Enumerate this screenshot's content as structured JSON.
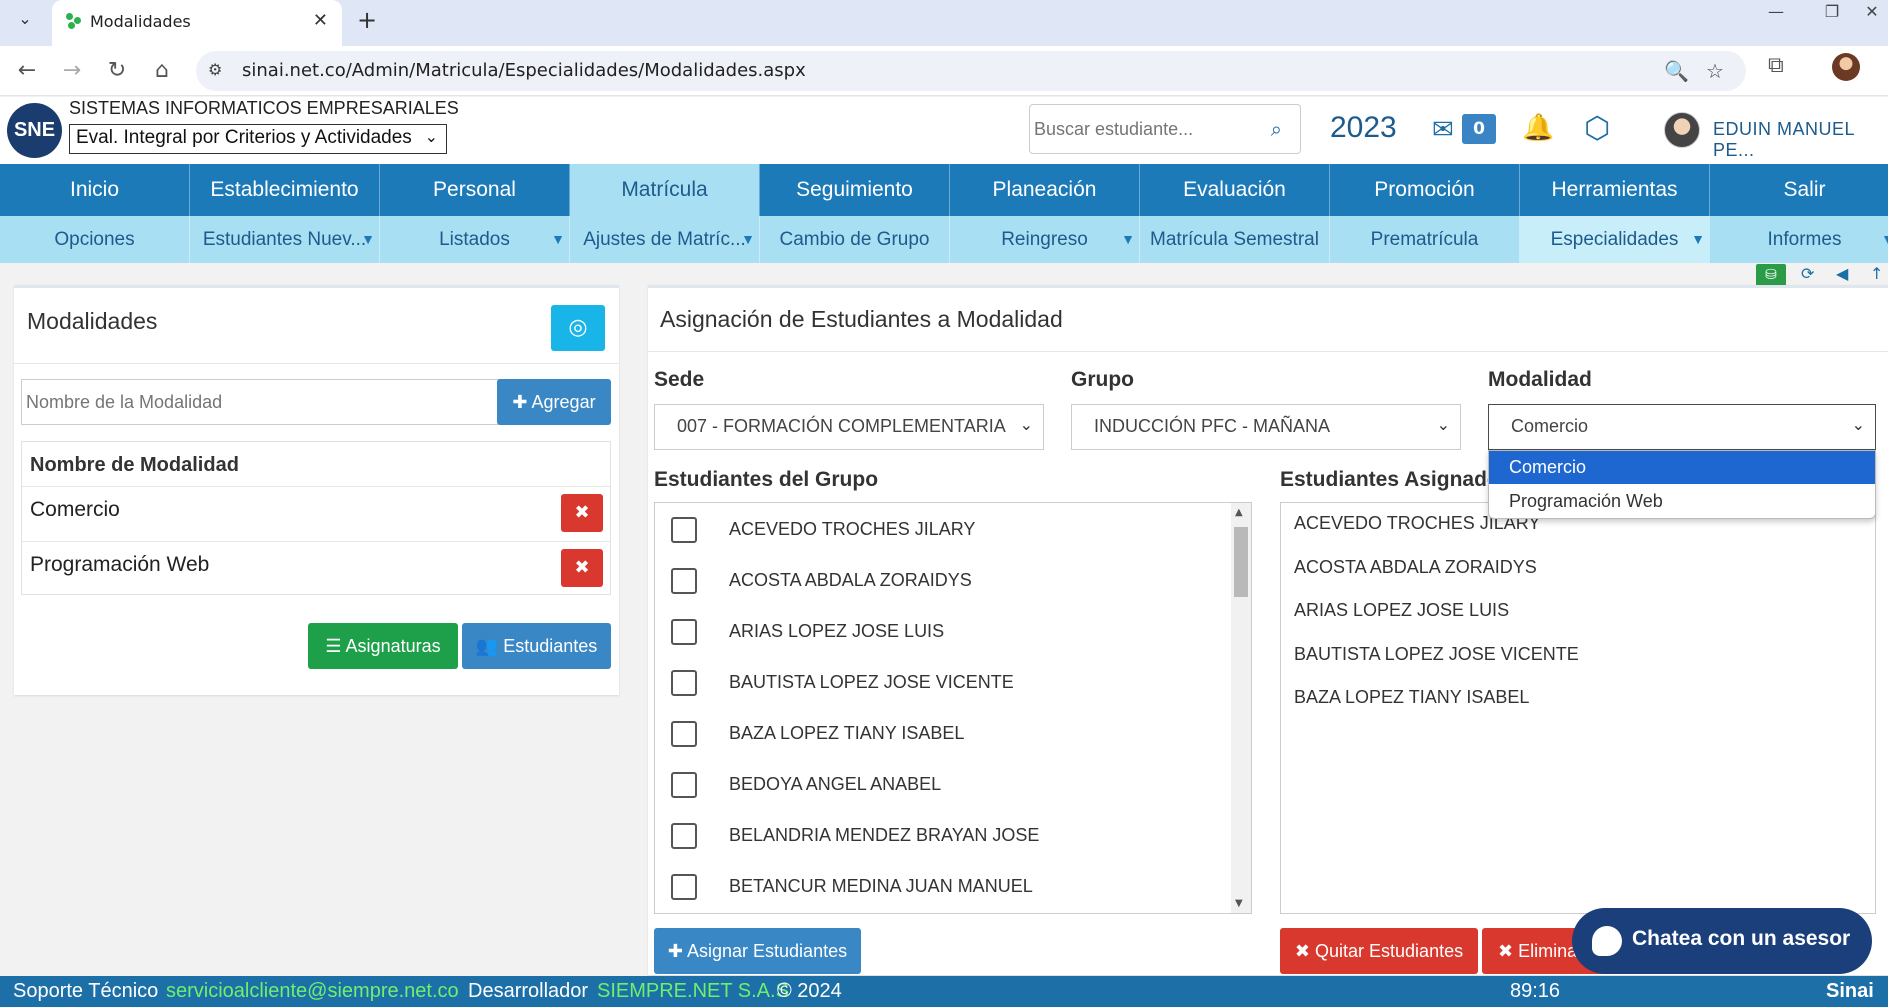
{
  "browser": {
    "tab_title": "Modalidades",
    "url": "sinai.net.co/Admin/Matricula/Especialidades/Modalidades.aspx"
  },
  "header": {
    "company": "SISTEMAS INFORMATICOS EMPRESARIALES",
    "logo_text": "SNE",
    "eval_select": "Eval. Integral por Criterios y Actividades",
    "search_placeholder": "Buscar estudiante...",
    "year": "2023",
    "mail_count": "0",
    "username": "EDUIN MANUEL PE..."
  },
  "main_menu": [
    "Inicio",
    "Establecimiento",
    "Personal",
    "Matrícula",
    "Seguimiento",
    "Planeación",
    "Evaluación",
    "Promoción",
    "Herramientas",
    "Salir"
  ],
  "sub_menu": [
    {
      "label": "Opciones",
      "caret": false
    },
    {
      "label": "Estudiantes Nuev...",
      "caret": true
    },
    {
      "label": "Listados",
      "caret": true
    },
    {
      "label": "Ajustes de Matríc...",
      "caret": true
    },
    {
      "label": "Cambio de Grupo",
      "caret": false
    },
    {
      "label": "Reingreso",
      "caret": true
    },
    {
      "label": "Matrícula Semestral",
      "caret": false
    },
    {
      "label": "Prematrícula",
      "caret": false
    },
    {
      "label": "Especialidades",
      "caret": true
    },
    {
      "label": "Informes",
      "caret": true
    }
  ],
  "left_panel": {
    "title": "Modalidades",
    "input_placeholder": "Nombre de la Modalidad",
    "add_button": "Agregar",
    "table_header": "Nombre de Modalidad",
    "rows": [
      "Comercio",
      "Programación Web"
    ],
    "btn_asignaturas": "Asignaturas",
    "btn_estudiantes": "Estudiantes"
  },
  "right_panel": {
    "title": "Asignación de Estudiantes a Modalidad",
    "sede_label": "Sede",
    "sede_value": "007 - FORMACIÓN COMPLEMENTARIA",
    "grupo_label": "Grupo",
    "grupo_value": "INDUCCIÓN PFC - MAÑANA",
    "modalidad_label": "Modalidad",
    "modalidad_value": "Comercio",
    "modalidad_options": [
      "Comercio",
      "Programación Web"
    ],
    "group_list_label": "Estudiantes del Grupo",
    "assigned_list_label": "Estudiantes Asignados",
    "group_students": [
      "ACEVEDO TROCHES JILARY",
      "ACOSTA ABDALA ZORAIDYS",
      "ARIAS LOPEZ JOSE  LUIS",
      "BAUTISTA LOPEZ JOSE VICENTE",
      "BAZA LOPEZ TIANY ISABEL",
      "BEDOYA ANGEL ANABEL",
      "BELANDRIA MENDEZ BRAYAN JOSE",
      "BETANCUR MEDINA JUAN MANUEL"
    ],
    "assigned_students": [
      "ACEVEDO TROCHES JILARY",
      "ACOSTA ABDALA ZORAIDYS",
      "ARIAS LOPEZ JOSE  LUIS",
      "BAUTISTA LOPEZ JOSE VICENTE",
      "BAZA LOPEZ TIANY ISABEL"
    ],
    "btn_asignar": "Asignar Estudiantes",
    "btn_quitar": "Quitar Estudiantes",
    "btn_eliminar": "Elimina"
  },
  "chat": {
    "label": "Chatea con un asesor"
  },
  "footer": {
    "soporte": "Soporte Técnico",
    "email": "servicioalcliente@siempre.net.co",
    "desarrollador": "Desarrollador",
    "company": "SIEMPRE.NET S.A.S",
    "copyright": "© 2024",
    "timer": "89:16",
    "brand": "Sinai"
  }
}
